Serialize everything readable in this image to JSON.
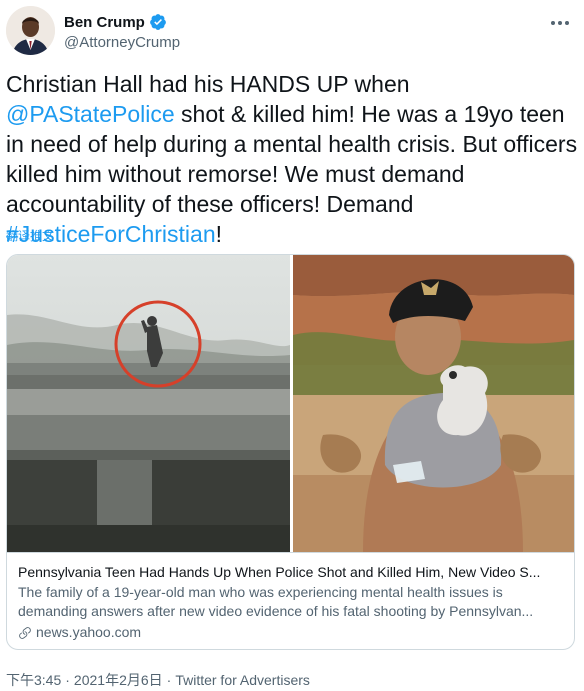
{
  "author": {
    "display_name": "Ben Crump",
    "handle": "@AttorneyCrump",
    "verified": true
  },
  "tweet": {
    "text_1": "Christian Hall had his HANDS UP when ",
    "mention": "@PAStatePolice",
    "text_2": " shot & killed him! He was a 19yo teen in need of help during a mental health crisis. But officers killed him without remorse! We must demand accountability of these officers! Demand ",
    "hashtag": "#JusticeForChristian",
    "text_3": "!",
    "translate_label": "翻译推文"
  },
  "card": {
    "title": "Pennsylvania Teen Had Hands Up When Police Shot and Killed Him, New Video S...",
    "description_line_1": "The family of a 19-year-old man who was experiencing mental health issues is",
    "description_line_2": "demanding answers after new video evidence of his fatal shooting by Pennsylvan...",
    "domain": "news.yahoo.com"
  },
  "meta": {
    "time": "下午3:45",
    "separator": "·",
    "date": "2021年2月6日",
    "source": "Twitter for Advertisers"
  },
  "icons": {
    "verified": "verified-badge-icon",
    "more": "more-dots-icon",
    "link": "link-icon"
  },
  "colors": {
    "accent": "#1d9bf0",
    "text": "#0f1419",
    "secondary": "#536471",
    "border": "#cfd9de"
  }
}
